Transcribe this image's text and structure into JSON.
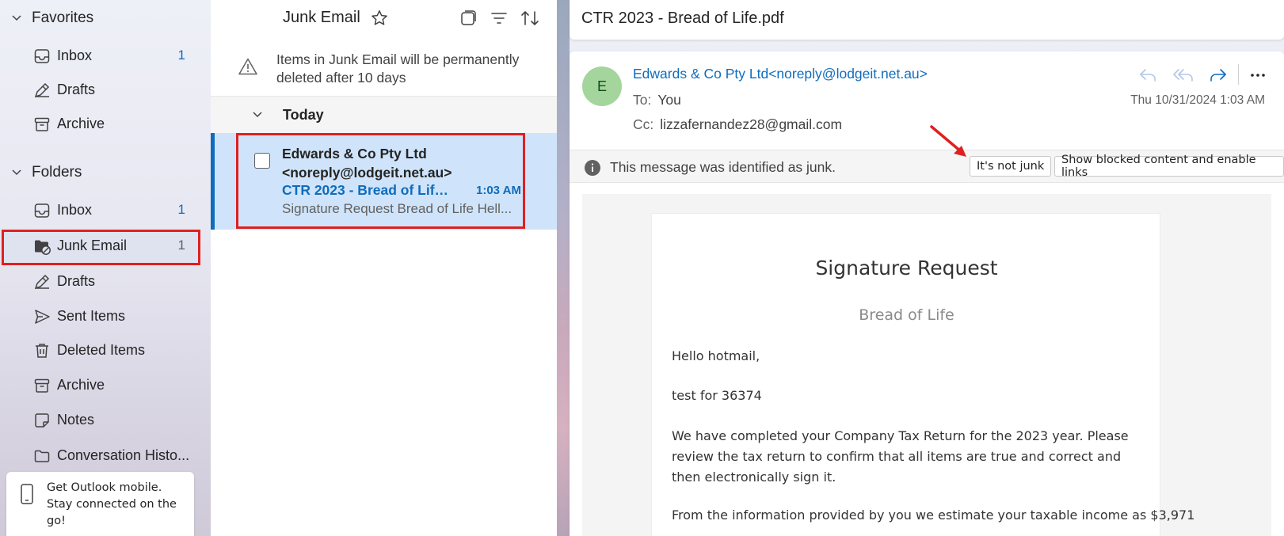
{
  "nav": {
    "favorites_label": "Favorites",
    "favorites": [
      {
        "label": "Inbox",
        "count": "1",
        "icon": "inbox-icon"
      },
      {
        "label": "Drafts",
        "count": "",
        "icon": "drafts-icon"
      },
      {
        "label": "Archive",
        "count": "",
        "icon": "archive-icon"
      }
    ],
    "folders_label": "Folders",
    "folders": [
      {
        "label": "Inbox",
        "count": "1",
        "icon": "inbox-icon"
      },
      {
        "label": "Junk Email",
        "count": "1",
        "icon": "junk-folder-icon",
        "selected": true
      },
      {
        "label": "Drafts",
        "count": "",
        "icon": "drafts-icon"
      },
      {
        "label": "Sent Items",
        "count": "",
        "icon": "send-icon"
      },
      {
        "label": "Deleted Items",
        "count": "",
        "icon": "trash-icon"
      },
      {
        "label": "Archive",
        "count": "",
        "icon": "archive-icon"
      },
      {
        "label": "Notes",
        "count": "",
        "icon": "note-icon"
      },
      {
        "label": "Conversation Histo...",
        "count": "",
        "icon": "folder-icon"
      }
    ],
    "promo_text": "Get Outlook mobile. Stay connected on the go!"
  },
  "list": {
    "title": "Junk Email",
    "notice": "Items in Junk Email will be permanently deleted after 10 days",
    "group_label": "Today",
    "message": {
      "from_line1": "Edwards & Co Pty Ltd",
      "from_line2": "<noreply@lodgeit.net.au>",
      "subject": "CTR 2023 - Bread of Life....",
      "time": "1:03 AM",
      "preview": "Signature Request Bread of Life Hell..."
    }
  },
  "reading": {
    "subject": "CTR 2023 - Bread of Life.pdf",
    "avatar_letter": "E",
    "sender": "Edwards & Co Pty Ltd<noreply@lodgeit.net.au>",
    "to_label": "To:",
    "to_value": "You",
    "cc_label": "Cc:",
    "cc_value": "lizzafernandez28@gmail.com",
    "date": "Thu 10/31/2024 1:03 AM",
    "junk_notice": "This message was identified as junk.",
    "not_junk_button": "It's not junk",
    "show_blocked_button": "Show blocked content and enable links",
    "body": {
      "heading": "Signature Request",
      "subheading": "Bread of Life",
      "greeting": "Hello hotmail,",
      "line1": "test for 36374",
      "para1": "We have completed your Company Tax Return for the 2023 year. Please review the tax return to confirm that all items are true and correct and then electronically sign it.",
      "para2": "From the information provided by you we estimate your taxable income as $3,971"
    }
  },
  "colors": {
    "accent": "#0f6cbd",
    "selected_row": "#cfe4fa",
    "highlight_box": "#e02020",
    "avatar_bg": "#a4d59c"
  }
}
